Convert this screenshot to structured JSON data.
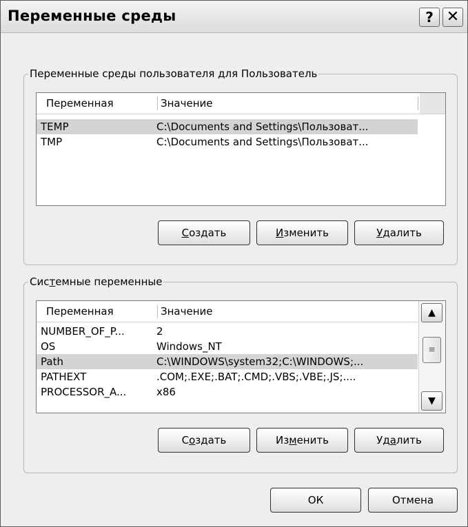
{
  "window": {
    "title": "Переменные среды",
    "help_glyph": "?",
    "close_glyph": "✕"
  },
  "user_vars": {
    "legend": "Переменные среды пользователя для Пользователь",
    "columns": [
      "Переменная",
      "Значение"
    ],
    "rows": [
      {
        "name": "TEMP",
        "value": "C:\\Documents and Settings\\Пользоват...",
        "selected": true
      },
      {
        "name": "TMP",
        "value": "C:\\Documents and Settings\\Пользоват...",
        "selected": false
      }
    ],
    "create_label": "Создать",
    "edit_label": "Изменить",
    "delete_label": "Удалить"
  },
  "system_vars": {
    "legend": "Системные переменные",
    "columns": [
      "Переменная",
      "Значение"
    ],
    "rows": [
      {
        "name": "NUMBER_OF_P...",
        "value": "2",
        "selected": false
      },
      {
        "name": "OS",
        "value": "Windows_NT",
        "selected": false
      },
      {
        "name": "Path",
        "value": "C:\\WINDOWS\\system32;C:\\WINDOWS;...",
        "selected": true
      },
      {
        "name": "PATHEXT",
        "value": ".COM;.EXE;.BAT;.CMD;.VBS;.VBE;.JS;....",
        "selected": false
      },
      {
        "name": "PROCESSOR_A...",
        "value": "x86",
        "selected": false
      }
    ],
    "create_label": "Создать",
    "edit_label": "Изменить",
    "delete_label": "Удалить"
  },
  "footer": {
    "ok_label": "ОК",
    "cancel_label": "Отмена"
  },
  "icons": {
    "scroll_up": "▲",
    "scroll_down": "▼",
    "thumb_grip": "≡"
  }
}
